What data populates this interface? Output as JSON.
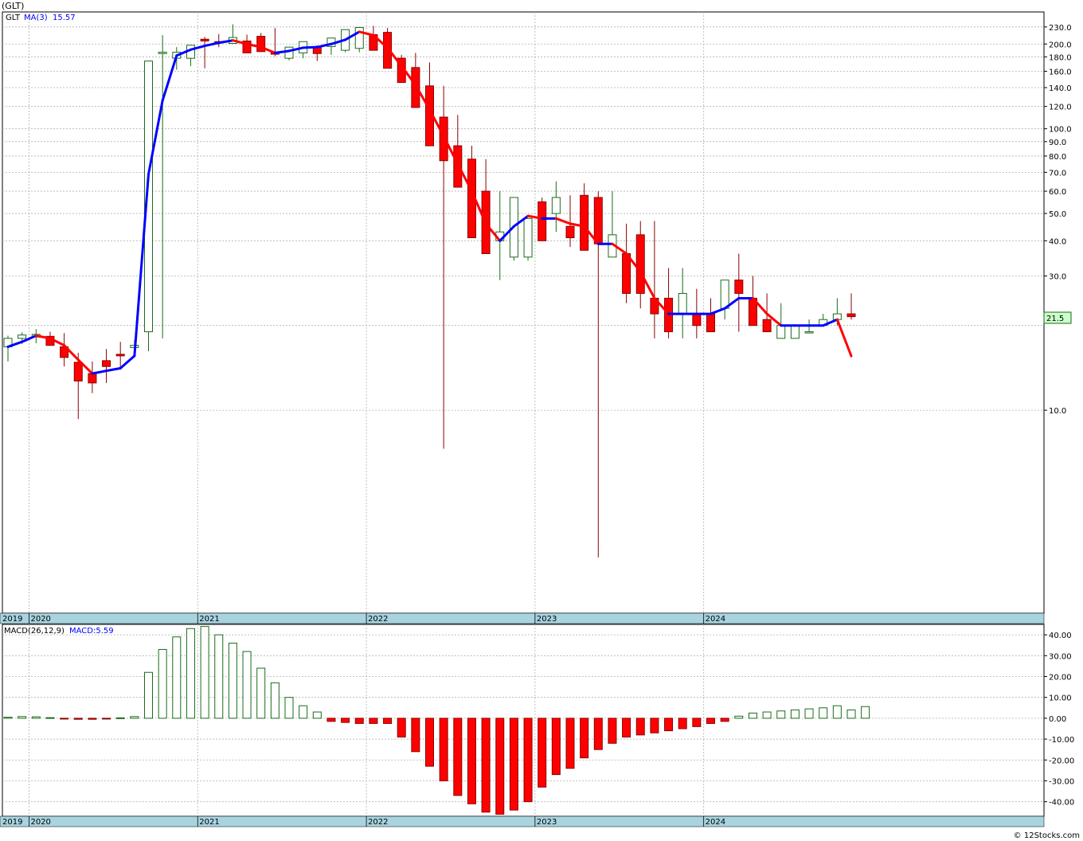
{
  "header": {
    "symbol": "(GLT)"
  },
  "price_panel": {
    "label": "GLT",
    "ma_label": "MA(3)",
    "ma_value": "15.57",
    "last_price_tag": "21.5",
    "y_tick_labels": [
      "230.0",
      "200.0",
      "180.0",
      "160.0",
      "140.0",
      "120.0",
      "100.0",
      "90.0",
      "80.0",
      "70.0",
      "60.0",
      "50.0",
      "40.0",
      "30.0",
      "10.0"
    ]
  },
  "macd_panel": {
    "label": "MACD(26,12,9)",
    "value_label": "MACD:5.59",
    "y_tick_labels": [
      "40.00",
      "30.00",
      "20.00",
      "10.00",
      "0.00",
      "-10.00",
      "-20.00",
      "-30.00",
      "-40.00"
    ]
  },
  "time_axis": {
    "year_labels": [
      "2019",
      "2020",
      "2021",
      "2022",
      "2023",
      "2024"
    ]
  },
  "footer": {
    "credit": "© 12Stocks.com"
  },
  "colors": {
    "up": "#1a6b1a",
    "down": "#ff0000",
    "ma_up": "#0000ff",
    "ma_down": "#ff0000",
    "axis_band": "#a8d4e0"
  },
  "chart_data": [
    {
      "type": "candlestick",
      "title": "(GLT)",
      "y_scale": "log",
      "ylim": [
        1.9,
        260
      ],
      "x": [
        "2019-11",
        "2019-12",
        "2020-01",
        "2020-02",
        "2020-03",
        "2020-04",
        "2020-05",
        "2020-06",
        "2020-07",
        "2020-08",
        "2020-09",
        "2020-10",
        "2020-11",
        "2020-12",
        "2021-01",
        "2021-02",
        "2021-03",
        "2021-04",
        "2021-05",
        "2021-06",
        "2021-07",
        "2021-08",
        "2021-09",
        "2021-10",
        "2021-11",
        "2021-12",
        "2022-01",
        "2022-02",
        "2022-03",
        "2022-04",
        "2022-05",
        "2022-06",
        "2022-07",
        "2022-08",
        "2022-09",
        "2022-10",
        "2022-11",
        "2022-12",
        "2023-01",
        "2023-02",
        "2023-03",
        "2023-04",
        "2023-05",
        "2023-06",
        "2023-07",
        "2023-08",
        "2023-09",
        "2023-10",
        "2023-11",
        "2023-12",
        "2024-01",
        "2024-02",
        "2024-03",
        "2024-04",
        "2024-05",
        "2024-06",
        "2024-07",
        "2024-08",
        "2024-09",
        "2024-10",
        "2024-11",
        "2024-12",
        "2025-01"
      ],
      "open": [
        16.8,
        18.0,
        18.2,
        18.3,
        16.8,
        14.8,
        13.5,
        15.0,
        15.8,
        16.7,
        19.0,
        185,
        178,
        178,
        208,
        204,
        201,
        205,
        213,
        186,
        178,
        186,
        195,
        196,
        190,
        193,
        216,
        220,
        178,
        165,
        142,
        110,
        87,
        78,
        60,
        40,
        35,
        35,
        55,
        50,
        45,
        58,
        57,
        35,
        36,
        42,
        25,
        25,
        22,
        22,
        22,
        23,
        29,
        25,
        21,
        18,
        18,
        19,
        20,
        21,
        22
      ],
      "high": [
        18.4,
        18.9,
        19.4,
        19.0,
        18.8,
        16.0,
        14.9,
        16.5,
        17.5,
        17.8,
        20.8,
        215,
        195,
        188,
        212,
        217,
        235,
        216,
        219,
        228,
        193,
        193,
        198,
        198,
        202,
        206,
        232,
        228,
        183,
        186,
        172,
        142,
        112,
        87,
        78,
        60,
        42,
        42,
        57,
        65,
        58,
        64,
        60,
        60,
        46,
        47,
        47,
        32,
        32,
        27,
        25,
        28,
        36,
        30,
        26,
        24,
        20,
        21,
        22,
        25,
        26
      ],
      "low": [
        14.9,
        17.2,
        17.3,
        17.2,
        14.3,
        9.3,
        11.5,
        12.5,
        14.0,
        15.8,
        16.2,
        18.0,
        162,
        167,
        164,
        195,
        200,
        195,
        193,
        181,
        175,
        178,
        174,
        183,
        187,
        187,
        205,
        192,
        165,
        138,
        102,
        7.3,
        80,
        63,
        40,
        29,
        34,
        34,
        46,
        43,
        38,
        37,
        3.0,
        36,
        24,
        23,
        18,
        18,
        18,
        18,
        21,
        21,
        19,
        21,
        19,
        18,
        19,
        19,
        21,
        20,
        21
      ],
      "close": [
        18.0,
        18.5,
        18.6,
        17.0,
        15.4,
        12.7,
        12.5,
        14.3,
        15.6,
        17.0,
        174,
        187,
        187,
        198,
        205,
        203,
        211,
        186,
        188,
        184,
        195,
        204,
        185,
        210,
        225,
        229,
        190,
        164,
        146,
        119,
        87,
        77,
        62,
        41,
        36,
        43,
        57,
        48,
        40,
        57,
        41,
        37,
        39,
        42,
        26,
        26,
        22,
        19,
        26,
        20,
        19,
        29,
        26,
        20,
        19,
        20,
        20,
        19,
        21,
        22,
        21.5
      ],
      "ma3": [
        16.8,
        17.5,
        18.4,
        18.0,
        17.0,
        15.1,
        13.5,
        13.8,
        14.1,
        15.6,
        69,
        126,
        182,
        191,
        197,
        202,
        206,
        200,
        195,
        186,
        189,
        194,
        195,
        200,
        207,
        221,
        215,
        194,
        167,
        143,
        117,
        94,
        75,
        60,
        46,
        40,
        45,
        49,
        48,
        48,
        46,
        45,
        39,
        39,
        36,
        31,
        25,
        22,
        22,
        22,
        22,
        23,
        25,
        25,
        22,
        20,
        20,
        20,
        20,
        21,
        15.57
      ]
    },
    {
      "type": "bar",
      "title": "MACD(26,12,9)",
      "ylim": [
        -47,
        45
      ],
      "x": [
        "2019-11",
        "2019-12",
        "2020-01",
        "2020-02",
        "2020-03",
        "2020-04",
        "2020-05",
        "2020-06",
        "2020-07",
        "2020-08",
        "2020-09",
        "2020-10",
        "2020-11",
        "2020-12",
        "2021-01",
        "2021-02",
        "2021-03",
        "2021-04",
        "2021-05",
        "2021-06",
        "2021-07",
        "2021-08",
        "2021-09",
        "2021-10",
        "2021-11",
        "2021-12",
        "2022-01",
        "2022-02",
        "2022-03",
        "2022-04",
        "2022-05",
        "2022-06",
        "2022-07",
        "2022-08",
        "2022-09",
        "2022-10",
        "2022-11",
        "2022-12",
        "2023-01",
        "2023-02",
        "2023-03",
        "2023-04",
        "2023-05",
        "2023-06",
        "2023-07",
        "2023-08",
        "2023-09",
        "2023-10",
        "2023-11",
        "2023-12",
        "2024-01",
        "2024-02",
        "2024-03",
        "2024-04",
        "2024-05",
        "2024-06",
        "2024-07",
        "2024-08",
        "2024-09",
        "2024-10",
        "2024-11",
        "2024-12",
        "2025-01"
      ],
      "values": [
        0.5,
        0.8,
        0.7,
        0.3,
        -0.2,
        -0.5,
        -0.5,
        -0.3,
        0.2,
        0.8,
        22,
        33,
        39,
        43,
        44,
        40,
        36,
        32,
        24,
        17,
        10,
        6,
        3,
        -1.5,
        -2,
        -2.5,
        -2.5,
        -2.5,
        -9,
        -16,
        -23,
        -30,
        -37,
        -41,
        -45,
        -46,
        -44,
        -40,
        -33,
        -27,
        -24,
        -19,
        -15,
        -12,
        -9,
        -8,
        -7,
        -6,
        -5,
        -4,
        -2.5,
        -1.5,
        1.0,
        2.5,
        3.0,
        3.5,
        4.0,
        4.5,
        5.0,
        6.0,
        4.0,
        5.59
      ]
    }
  ]
}
